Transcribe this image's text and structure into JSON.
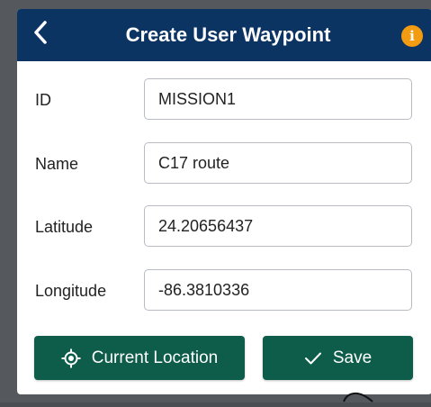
{
  "header": {
    "title": "Create User Waypoint",
    "back_icon": "chevron-left-icon",
    "info_icon": "info-icon",
    "info_glyph": "i",
    "background": "#0b3463",
    "info_color": "#f39c12"
  },
  "form": {
    "id": {
      "label": "ID",
      "value": "MISSION1"
    },
    "name": {
      "label": "Name",
      "value": "C17 route"
    },
    "latitude": {
      "label": "Latitude",
      "value": "24.20656437"
    },
    "longitude": {
      "label": "Longitude",
      "value": "-86.3810336"
    }
  },
  "actions": {
    "current_location": {
      "label": "Current Location",
      "icon": "crosshair-icon"
    },
    "save": {
      "label": "Save",
      "icon": "check-icon"
    },
    "button_color": "#0e5c4a"
  }
}
